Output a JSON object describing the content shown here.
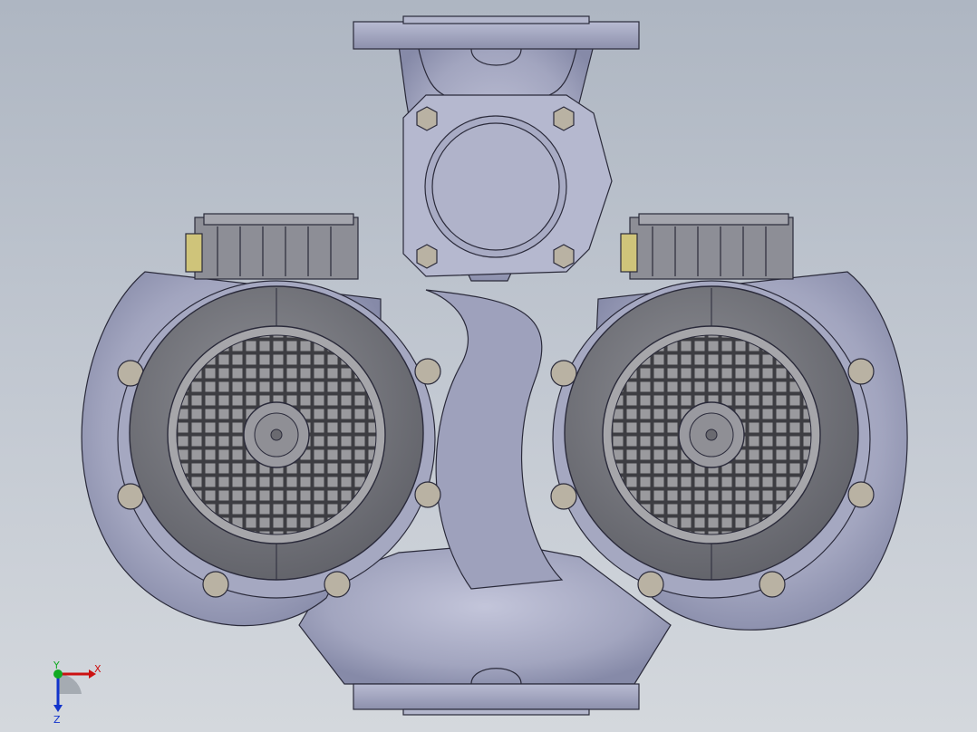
{
  "viewport": {
    "background_top": "#aeb6c2",
    "background_bottom": "#d4d8dd"
  },
  "model": {
    "body_color": "#a3a6c0",
    "edge_color": "#2a2a3a",
    "motor_cover_color": "#7b7c82",
    "grille_color": "#8e8e92",
    "bolt_color": "#b9b2a3",
    "terminal_box_color": "#8d8e96"
  },
  "triad": {
    "x_label": "X",
    "y_label": "Y",
    "z_label": "Z",
    "x_color": "#cc1111",
    "y_color": "#11aa22",
    "z_color": "#1133cc"
  }
}
